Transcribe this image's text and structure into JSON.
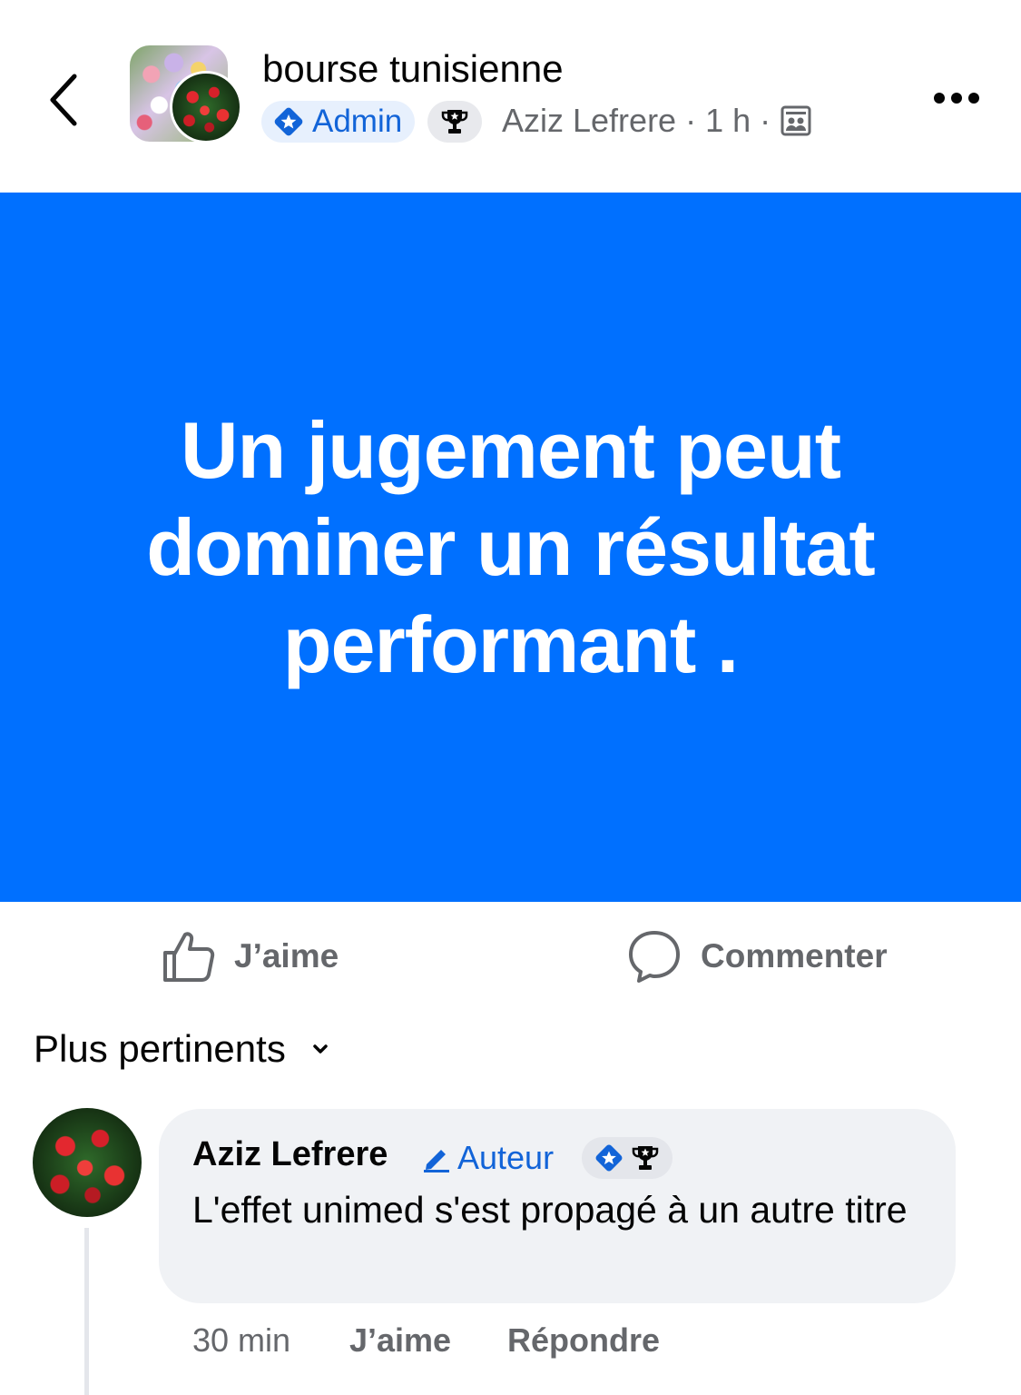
{
  "header": {
    "group_name": "bourse tunisienne",
    "admin_label": "Admin",
    "author_name": "Aziz Lefrere",
    "separator": "·",
    "time": "1 h"
  },
  "post": {
    "text": "Un jugement peut dominer un résultat performant .",
    "background_color": "#0070ff"
  },
  "actions": {
    "like_label": "J’aime",
    "comment_label": "Commenter"
  },
  "comments_section": {
    "sort_label": "Plus pertinents"
  },
  "comment": {
    "author": "Aziz Lefrere",
    "author_badge": "Auteur",
    "text": "L'effet unimed s'est propagé à un autre titre",
    "time": "30 min",
    "like_label": "J’aime",
    "reply_label": "Répondre"
  },
  "colors": {
    "accent": "#1264d8",
    "secondary_text": "#65676b",
    "bubble": "#f0f2f5"
  },
  "icons": [
    "back-chevron-icon",
    "admin-star-icon",
    "trophy-icon",
    "group-members-icon",
    "more-icon",
    "like-icon",
    "comment-icon",
    "chevron-down-icon",
    "pencil-icon"
  ]
}
